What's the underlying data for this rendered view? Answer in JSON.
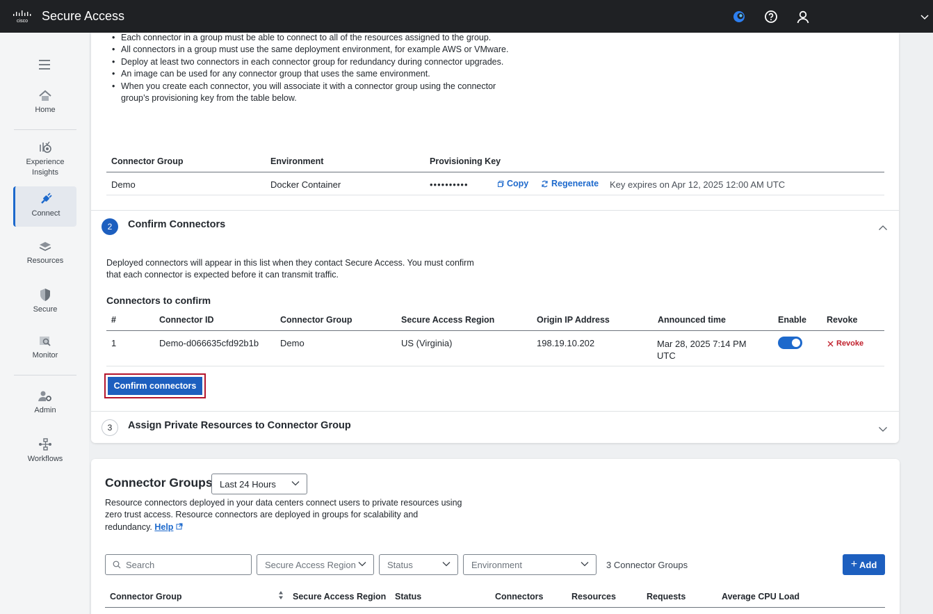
{
  "header": {
    "brand": "cisco",
    "title": "Secure Access"
  },
  "sidebar": {
    "items": [
      {
        "label": "Home"
      },
      {
        "label": "Experience Insights"
      },
      {
        "label": "Connect"
      },
      {
        "label": "Resources"
      },
      {
        "label": "Secure"
      },
      {
        "label": "Monitor"
      },
      {
        "label": "Admin"
      },
      {
        "label": "Workflows"
      }
    ]
  },
  "step1": {
    "bullet_1": "Each connector in a group must be able to connect to all of the resources assigned to the group.",
    "bullet_2": "All connectors in a group must use the same deployment environment, for example AWS or VMware.",
    "bullet_3": "Deploy at least two connectors in each connector group for redundancy during connector upgrades.",
    "bullet_4": "An image can be used for any connector group that uses the same environment.",
    "bullet_5": "When you create each connector, you will associate it with a connector group using the connector group’s provisioning key from the table below.",
    "table": {
      "col_group": "Connector Group",
      "col_env": "Environment",
      "col_key": "Provisioning Key",
      "group": "Demo",
      "environment": "Docker Container",
      "key_masked": "••••••••••",
      "copy_label": "Copy",
      "regenerate_label": "Regenerate",
      "expiry": "Key expires on Apr 12, 2025 12:00 AM UTC"
    }
  },
  "step2": {
    "number": "2",
    "title": "Confirm Connectors",
    "description": "Deployed connectors will appear in this list when they contact Secure Access. You must confirm that each connector is expected before it can transmit traffic.",
    "subheading": "Connectors to confirm",
    "columns": {
      "num": "#",
      "id": "Connector ID",
      "group": "Connector Group",
      "region": "Secure Access Region",
      "ip": "Origin IP Address",
      "announced": "Announced time",
      "enable": "Enable",
      "revoke": "Revoke"
    },
    "row": {
      "num": "1",
      "id": "Demo-d066635cfd92b1b",
      "group": "Demo",
      "region": "US (Virginia)",
      "ip": "198.19.10.202",
      "announced": "Mar 28, 2025 7:14 PM UTC",
      "enabled": true,
      "revoke_label": "Revoke"
    },
    "confirm_button": "Confirm connectors"
  },
  "step3": {
    "number": "3",
    "title": "Assign Private Resources to Connector Group"
  },
  "connector_groups": {
    "title": "Connector Groups",
    "time_filter": "Last 24 Hours",
    "description": "Resource connectors deployed in your data centers connect users to private resources using zero trust access. Resource connectors are deployed in groups for scalability and redundancy.",
    "help_label": "Help",
    "search_placeholder": "Search",
    "filter_region": "Secure Access Region",
    "filter_status": "Status",
    "filter_env": "Environment",
    "count": "3 Connector Groups",
    "add_label": "Add",
    "columns": {
      "group": "Connector Group",
      "region": "Secure Access Region",
      "status": "Status",
      "connectors": "Connectors",
      "resources": "Resources",
      "requests": "Requests",
      "cpu": "Average CPU Load"
    }
  },
  "colors": {
    "accent": "#1d69cc",
    "button": "#1d5fbf",
    "revoke": "#c0202c",
    "highlight": "#b3142c",
    "topbar": "#1f2124"
  }
}
